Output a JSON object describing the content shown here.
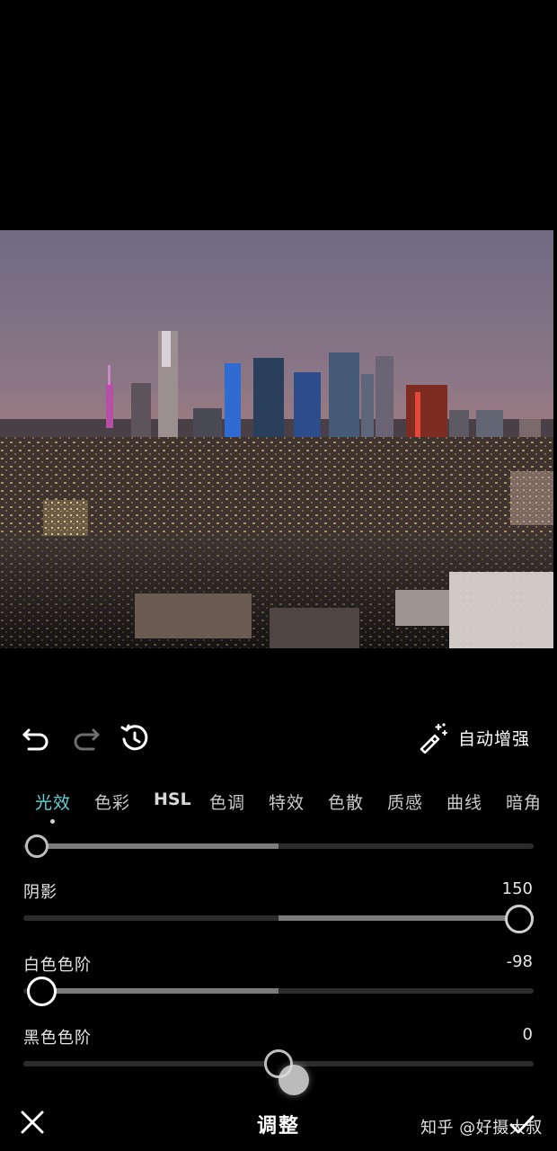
{
  "toolbar": {
    "undo_icon": "undo-icon",
    "redo_icon": "redo-icon",
    "reset_icon": "history-reset-icon",
    "auto_enhance_icon": "magic-wand-icon",
    "auto_enhance_label": "自动增强"
  },
  "tabs": [
    {
      "label": "光效",
      "active": true
    },
    {
      "label": "色彩",
      "active": false
    },
    {
      "label": "HSL",
      "active": false
    },
    {
      "label": "色调",
      "active": false
    },
    {
      "label": "特效",
      "active": false
    },
    {
      "label": "色散",
      "active": false
    },
    {
      "label": "质感",
      "active": false
    },
    {
      "label": "曲线",
      "active": false
    },
    {
      "label": "暗角",
      "active": false
    }
  ],
  "sliders": [
    {
      "label": "",
      "value": "",
      "position_fraction": 0.0
    },
    {
      "label": "阴影",
      "value": "150",
      "position_fraction": 1.0
    },
    {
      "label": "白色色阶",
      "value": "-98",
      "position_fraction": 0.01
    },
    {
      "label": "黑色色阶",
      "value": "0",
      "position_fraction": 0.5
    }
  ],
  "bottom_bar": {
    "title": "调整",
    "close_icon": "close-icon",
    "confirm_icon": "check-icon",
    "watermark": "知乎 @好摄大叔"
  },
  "colors": {
    "accent": "#5fd3d5",
    "background": "#000000",
    "track": "#2c2c2c",
    "track_fill": "#7b7b7b"
  }
}
